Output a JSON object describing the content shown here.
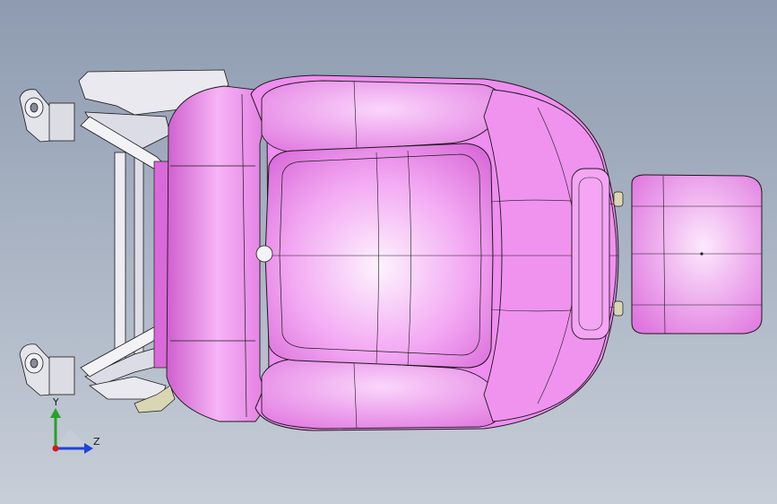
{
  "viewport": {
    "background_top": "#8e9bb0",
    "background_bottom": "#c7ced8"
  },
  "model": {
    "body_color": "#f08df0",
    "body_highlight": "#fbe3fb",
    "edge_color": "#1b1b1b",
    "frame_color": "#e7e7ee",
    "shadow_color": "#c55bc7",
    "fitting_color": "#d9d6b4"
  },
  "triad": {
    "y_label": "Y",
    "z_label": "Z",
    "y_color": "#26a12a",
    "z_color": "#2143d6",
    "x_color": "#d11b1b"
  }
}
